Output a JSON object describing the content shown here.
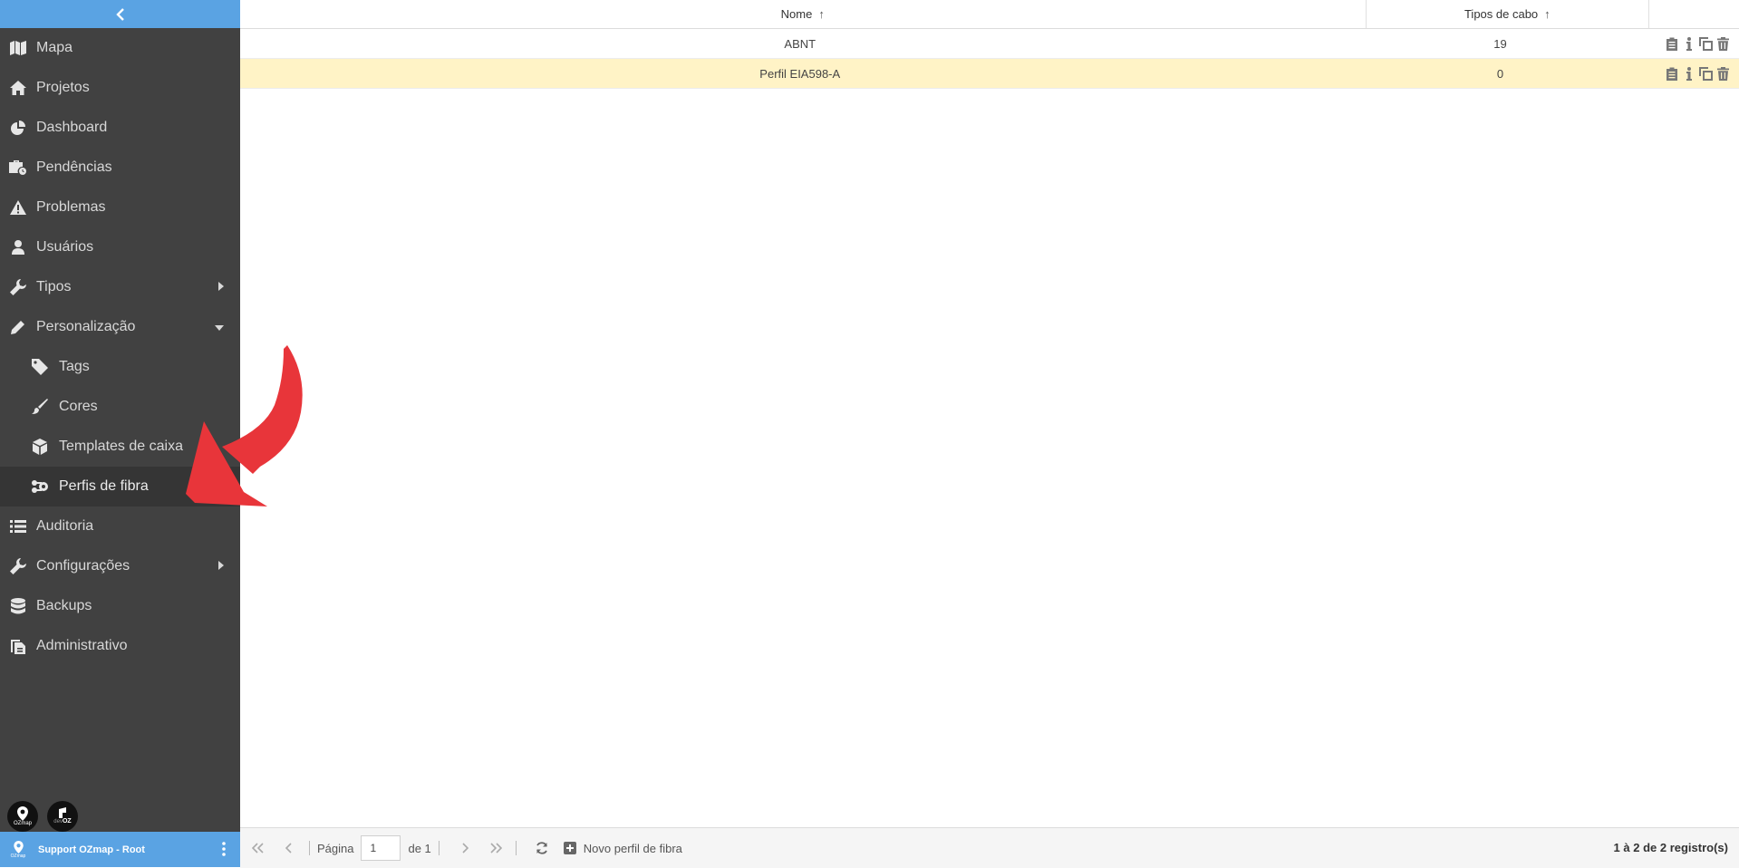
{
  "sidebar": {
    "items": [
      {
        "label": "Mapa",
        "icon": "map-icon"
      },
      {
        "label": "Projetos",
        "icon": "home-icon"
      },
      {
        "label": "Dashboard",
        "icon": "pie-chart-icon"
      },
      {
        "label": "Pendências",
        "icon": "briefcase-clock-icon"
      },
      {
        "label": "Problemas",
        "icon": "warning-icon"
      },
      {
        "label": "Usuários",
        "icon": "user-icon"
      },
      {
        "label": "Tipos",
        "icon": "wrench-icon"
      },
      {
        "label": "Personalização",
        "icon": "pencil-icon"
      },
      {
        "label": "Tags",
        "icon": "tag-icon"
      },
      {
        "label": "Cores",
        "icon": "brush-icon"
      },
      {
        "label": "Templates de caixa",
        "icon": "cube-icon"
      },
      {
        "label": "Perfis de fibra",
        "icon": "fiber-icon"
      },
      {
        "label": "Auditoria",
        "icon": "list-icon"
      },
      {
        "label": "Configurações",
        "icon": "wrench-icon"
      },
      {
        "label": "Backups",
        "icon": "database-icon"
      },
      {
        "label": "Administrativo",
        "icon": "clipboard-icon"
      }
    ],
    "active_item": "Perfis de fibra",
    "logos": {
      "ozmap": "OZmap",
      "devoz_prefix": "dev",
      "devoz_suffix": "OZ"
    },
    "user": {
      "name": "Support OZmap - Root",
      "pin_label": "OZmap"
    }
  },
  "table": {
    "columns": {
      "name": "Nome",
      "tipos": "Tipos de cabo"
    },
    "rows": [
      {
        "name": "ABNT",
        "tipos": "19"
      },
      {
        "name": "Perfil EIA598-A",
        "tipos": "0"
      }
    ]
  },
  "footer": {
    "page_label": "Página",
    "page_value": "1",
    "of_label": "de 1",
    "new_button": "Novo perfil de fibra",
    "records": "1 à 2 de 2 registro(s)"
  },
  "colors": {
    "sidebar_bg": "#414141",
    "accent_blue": "#5aa3e3",
    "highlight_row": "#fff3c6",
    "annotation_red": "#e8353a"
  }
}
